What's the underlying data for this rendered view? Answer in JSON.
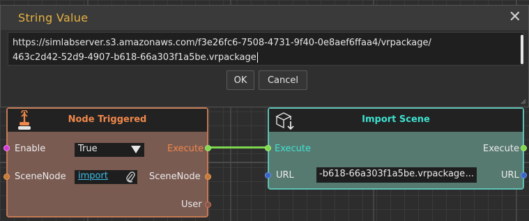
{
  "dialog": {
    "title": "String Value",
    "text_line1": "https://simlabserver.s3.amazonaws.com/f3e26fc6-7508-4731-9f40-0e8aef6ffaa4/vrpackage/",
    "text_line2": "463c2d42-52d9-4907-b618-66a303f1a5be.vrpackage",
    "ok_label": "OK",
    "cancel_label": "Cancel",
    "close_glyph": "✕"
  },
  "node_triggered": {
    "title": "Node Triggered",
    "icon": "touch-hand-icon",
    "inputs": [
      {
        "label": "Enable"
      },
      {
        "label": "SceneNode"
      }
    ],
    "outputs": [
      {
        "label": "Execute"
      },
      {
        "label": "SceneNode"
      },
      {
        "label": "User"
      }
    ],
    "enable_value": "True",
    "scenenode_value": "import",
    "colors": {
      "accent": "#c57a54",
      "body": "#7a5b52",
      "title": "#f0884a"
    }
  },
  "import_scene": {
    "title": "Import Scene",
    "icon": "import-box-icon",
    "inputs": [
      {
        "label": "Execute"
      },
      {
        "label": "URL"
      }
    ],
    "outputs": [
      {
        "label": "Execute"
      },
      {
        "label": "URL"
      }
    ],
    "url_value": "-b618-66a303f1a5be.vrpackage",
    "url_more": "...",
    "colors": {
      "accent": "#5ec2b6",
      "body": "#577a70",
      "title": "#3fe2d2"
    }
  },
  "colors": {
    "canvas": "#2d2d2d",
    "dialog_title": "#e8b341",
    "wire": "#7ed84e",
    "link": "#3fbde8"
  }
}
